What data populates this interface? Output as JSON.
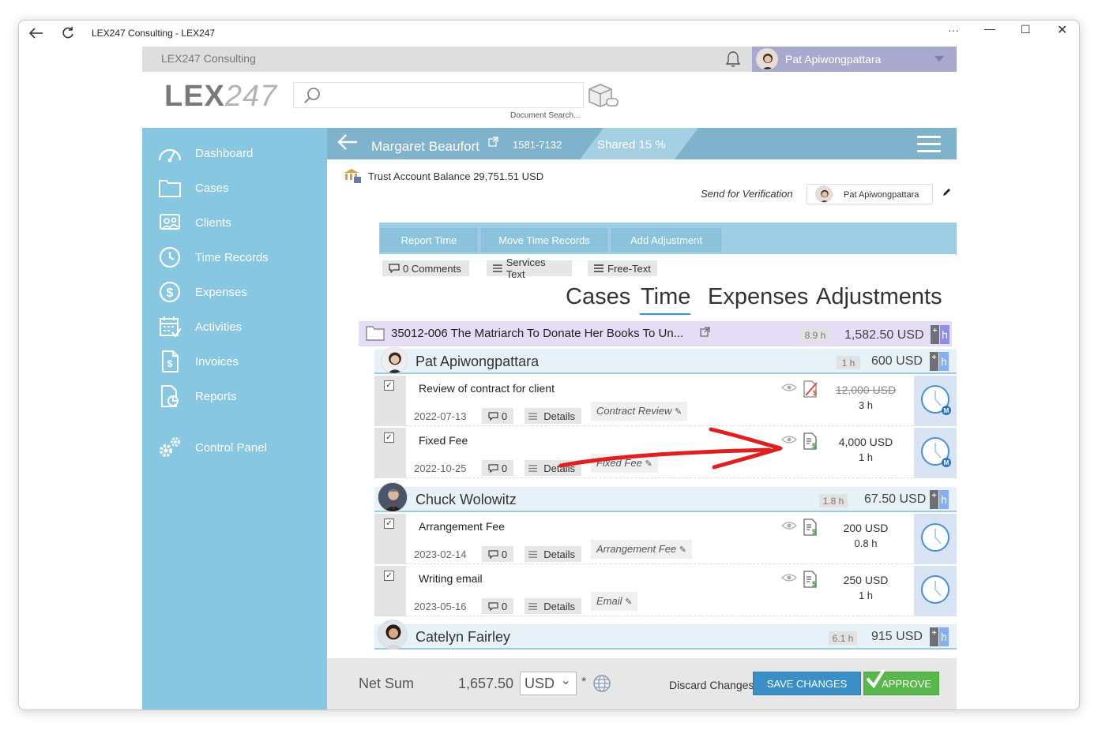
{
  "window": {
    "title": "LEX247 Consulting - LEX247"
  },
  "topbar": {
    "firm": "LEX247 Consulting",
    "user": "Pat Apiwongpattara"
  },
  "header": {
    "logo_left": "LEX",
    "logo_right": "247",
    "search_label": "Document Search..."
  },
  "sidebar": {
    "items": [
      {
        "label": "Dashboard",
        "icon": "dashboard-icon"
      },
      {
        "label": "Cases",
        "icon": "folder-icon"
      },
      {
        "label": "Clients",
        "icon": "clients-icon"
      },
      {
        "label": "Time Records",
        "icon": "clock-icon"
      },
      {
        "label": "Expenses",
        "icon": "dollar-icon"
      },
      {
        "label": "Activities",
        "icon": "calendar-icon"
      },
      {
        "label": "Invoices",
        "icon": "invoice-icon"
      },
      {
        "label": "Reports",
        "icon": "report-icon"
      },
      {
        "label": "Control Panel",
        "icon": "gears-icon"
      }
    ]
  },
  "case": {
    "client": "Margaret Beaufort",
    "number": "1581-7132",
    "shared": "Shared 15 %",
    "trust": "Trust Account Balance 29,751.51 USD",
    "send_verification": "Send for Verification",
    "verifier": "Pat Apiwongpattara"
  },
  "actions": {
    "report_time": "Report Time",
    "move_records": "Move Time Records",
    "add_adjustment": "Add Adjustment",
    "comments": "0 Comments",
    "services_text": "Services Text",
    "free_text": "Free-Text"
  },
  "tabs": [
    "Cases",
    "Time",
    "Expenses",
    "Adjustments"
  ],
  "case_row": {
    "title": "35012-006 The Matriarch To Donate Her Books To Un...",
    "hours": "8.9 h",
    "amount": "1,582.50 USD"
  },
  "groups": [
    {
      "name": "Pat Apiwongpattara",
      "hours": "1 h",
      "amount": "600 USD",
      "entries": [
        {
          "desc": "Review of contract for client",
          "date": "2022-07-13",
          "comments": "0",
          "details": "Details",
          "tag": "Contract Review",
          "price": "12,000 USD",
          "hours": "3 h",
          "strike": true
        },
        {
          "desc": "Fixed Fee",
          "date": "2022-10-25",
          "comments": "0",
          "details": "Details",
          "tag": "Fixed Fee",
          "price": "4,000 USD",
          "hours": "1 h",
          "strike": false
        }
      ]
    },
    {
      "name": "Chuck Wolowitz",
      "hours": "1.8 h",
      "amount": "67.50 USD",
      "entries": [
        {
          "desc": "Arrangement Fee",
          "date": "2023-02-14",
          "comments": "0",
          "details": "Details",
          "tag": "Arrangement Fee",
          "price": "200 USD",
          "hours": "0.8 h",
          "strike": false
        },
        {
          "desc": "Writing email",
          "date": "2023-05-16",
          "comments": "0",
          "details": "Details",
          "tag": "Email",
          "price": "250 USD",
          "hours": "1 h",
          "strike": false
        }
      ]
    },
    {
      "name": "Catelyn Fairley",
      "hours": "6.1 h",
      "amount": "915 USD",
      "entries": []
    }
  ],
  "footer": {
    "net_sum_label": "Net Sum",
    "net_sum_value": "1,657.50",
    "currency": "USD",
    "star": "*",
    "discard": "Discard Changes",
    "save": "SAVE CHANGES",
    "approve": "APPROVE"
  },
  "colors": {
    "sidebar": "#88c7e2",
    "casebar": "#7fb3cc",
    "case_row": "#e5dcf5",
    "save": "#3a8fc7",
    "approve": "#59b84c",
    "annotation_arrow": "#e02020"
  }
}
